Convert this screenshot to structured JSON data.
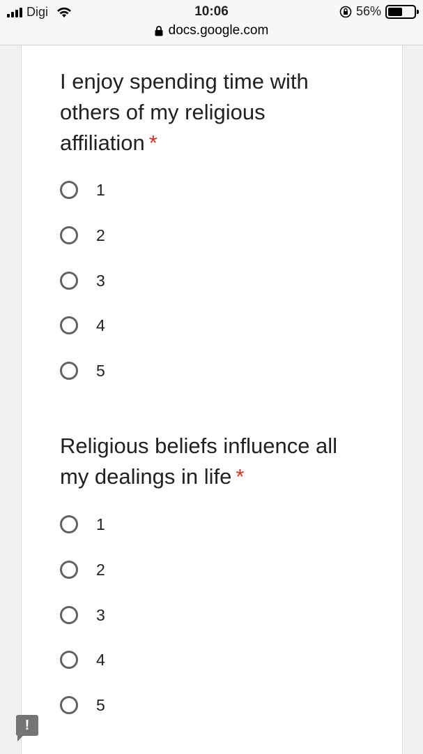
{
  "status_bar": {
    "carrier": "Digi",
    "time": "10:06",
    "battery_percent": "56%",
    "battery_level": 0.56
  },
  "browser": {
    "url": "docs.google.com"
  },
  "questions": [
    {
      "title": "I enjoy spending time with others of my religious affiliation",
      "required_mark": "*",
      "options": [
        "1",
        "2",
        "3",
        "4",
        "5"
      ]
    },
    {
      "title": "Religious beliefs influence all my dealings in life",
      "required_mark": "*",
      "options": [
        "1",
        "2",
        "3",
        "4",
        "5"
      ]
    }
  ],
  "feedback": {
    "label": "!"
  },
  "colors": {
    "required": "#d93025",
    "radio_border": "#5f6368"
  },
  "icons": [
    "signal-icon",
    "wifi-icon",
    "rotation-lock-icon",
    "battery-icon",
    "lock-icon",
    "feedback-icon"
  ]
}
